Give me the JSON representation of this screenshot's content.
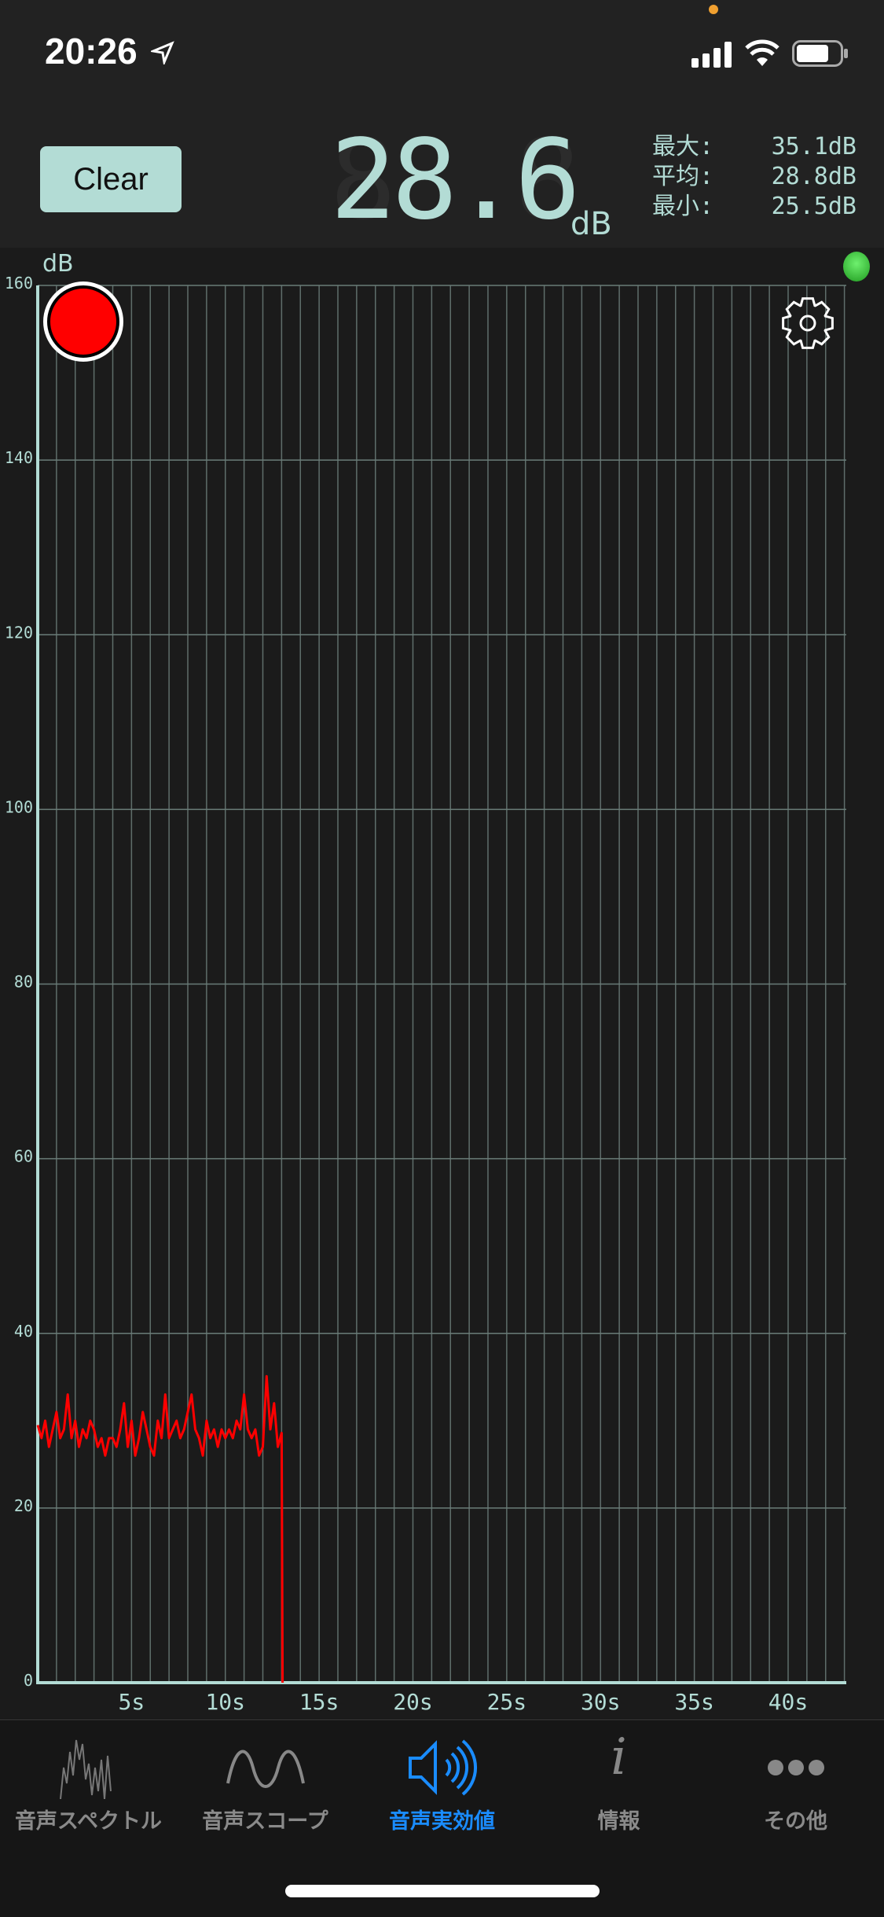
{
  "status_bar": {
    "time": "20:26",
    "location_icon": "location-arrow-icon",
    "signal_icon": "cellular-signal-icon",
    "wifi_icon": "wifi-icon",
    "battery_icon": "battery-icon"
  },
  "header": {
    "clear_label": "Clear",
    "current_value": "28.6",
    "unit": "dB",
    "stats": [
      {
        "label": "最大:",
        "value": "35.1dB"
      },
      {
        "label": "平均:",
        "value": "28.8dB"
      },
      {
        "label": "最小:",
        "value": "25.5dB"
      }
    ]
  },
  "colors": {
    "accent": "#b3dcd5",
    "line": "#ff0000",
    "active_tab": "#1a8cff",
    "inactive_tab": "#8a8a8a",
    "led": "#3ccf3c"
  },
  "chart_data": {
    "type": "line",
    "ylabel": "dB",
    "ylim": [
      0,
      160
    ],
    "xlim": [
      0,
      43.1
    ],
    "y_ticks": [
      "0",
      "20",
      "40",
      "60",
      "80",
      "100",
      "120",
      "140",
      "160"
    ],
    "x_ticks": [
      "5s",
      "10s",
      "15s",
      "20s",
      "25s",
      "30s",
      "35s",
      "40s"
    ],
    "grid": true,
    "x_step_s": 0.2,
    "values": [
      29.5,
      28,
      30,
      27,
      29,
      31,
      28,
      29,
      33,
      28,
      30,
      27,
      29,
      28,
      30,
      29,
      27,
      28,
      26,
      28,
      28,
      27,
      29,
      32,
      27,
      30,
      26,
      28,
      31,
      29,
      27,
      26,
      30,
      28,
      33,
      28,
      29,
      30,
      28,
      29,
      31,
      33,
      29,
      28,
      26,
      30,
      28,
      29,
      27,
      29,
      28,
      29,
      28,
      30,
      29,
      33,
      29,
      28,
      29,
      26,
      27,
      35.1,
      29,
      32,
      27,
      28.6,
      0
    ]
  },
  "tabs": [
    {
      "label": "音声スペクトル",
      "icon": "spectrum-icon"
    },
    {
      "label": "音声スコープ",
      "icon": "sine-wave-icon"
    },
    {
      "label": "音声実効値",
      "icon": "speaker-icon",
      "active": true
    },
    {
      "label": "情報",
      "icon": "info-icon"
    },
    {
      "label": "その他",
      "icon": "more-icon"
    }
  ]
}
